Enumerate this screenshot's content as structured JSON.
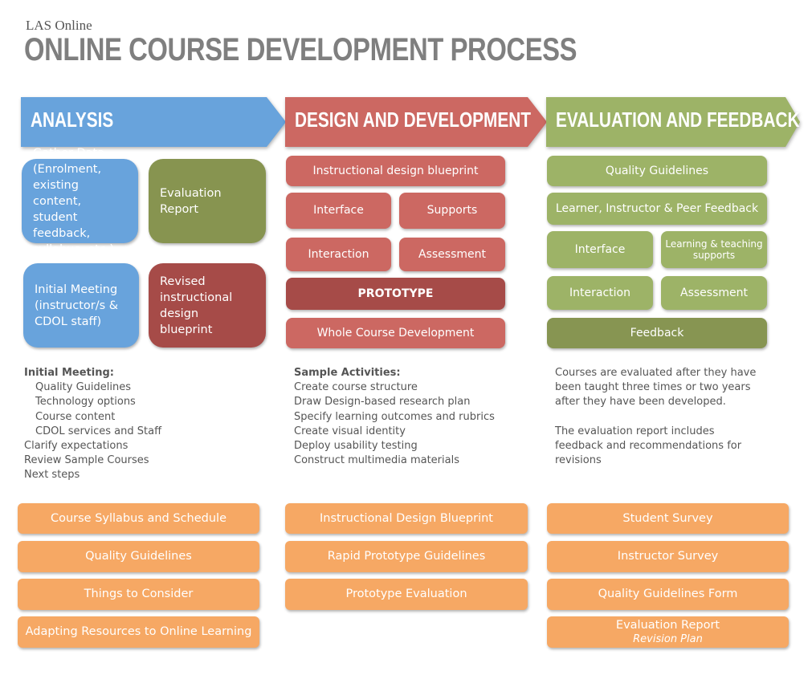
{
  "header": {
    "org": "LAS Online",
    "title": "ONLINE COURSE DEVELOPMENT PROCESS"
  },
  "colors": {
    "analysis": "#68a3dc",
    "design": "#cc6862",
    "evaluation": "#9db367",
    "resources": "#f6a864",
    "title": "#7f7f7f"
  },
  "phases": [
    {
      "title": "ANALYSIS",
      "boxes": [
        "Gather Data (Enrolment, existing content, student feedback, syllabus, etc.)",
        "Evaluation Report",
        "Initial Meeting (instructor/s & CDOL staff)",
        "Revised instructional design blueprint"
      ],
      "notes": {
        "heading": "Initial Meeting:",
        "sub": [
          "Quality Guidelines",
          "Technology options",
          "Course content",
          "CDOL services and Staff"
        ],
        "items": [
          "Clarify expectations",
          "Review Sample Courses",
          "Next steps"
        ]
      },
      "resources": [
        "Course Syllabus and Schedule",
        "Quality Guidelines",
        "Things to Consider",
        "Adapting Resources to Online Learning"
      ]
    },
    {
      "title": "DESIGN AND DEVELOPMENT",
      "boxes": [
        "Instructional design blueprint",
        "Interface",
        "Supports",
        "Interaction",
        "Assessment",
        "PROTOTYPE",
        "Whole Course Development"
      ],
      "notes": {
        "heading": "Sample Activities:",
        "items": [
          "Create course structure",
          "Draw Design-based research plan",
          "Specify learning outcomes and rubrics",
          "Create visual identity",
          "Deploy usability testing",
          "Construct multimedia materials"
        ]
      },
      "resources": [
        "Instructional Design Blueprint",
        "Rapid Prototype Guidelines",
        "Prototype Evaluation"
      ]
    },
    {
      "title": "EVALUATION AND FEEDBACK",
      "boxes": [
        "Quality Guidelines",
        "Learner, Instructor & Peer Feedback",
        "Interface",
        "Learning & teaching supports",
        "Interaction",
        "Assessment",
        "Feedback"
      ],
      "notes": {
        "lines": [
          "Courses are evaluated after they have",
          "been taught three times or two years",
          "after they have been developed.",
          "",
          "The evaluation report includes",
          "feedback and recommendations for",
          "revisions"
        ]
      },
      "resources": [
        "Student Survey",
        "Instructor Survey",
        "Quality Guidelines Form",
        "Evaluation Report"
      ],
      "resource_sub": "Revision Plan"
    }
  ]
}
